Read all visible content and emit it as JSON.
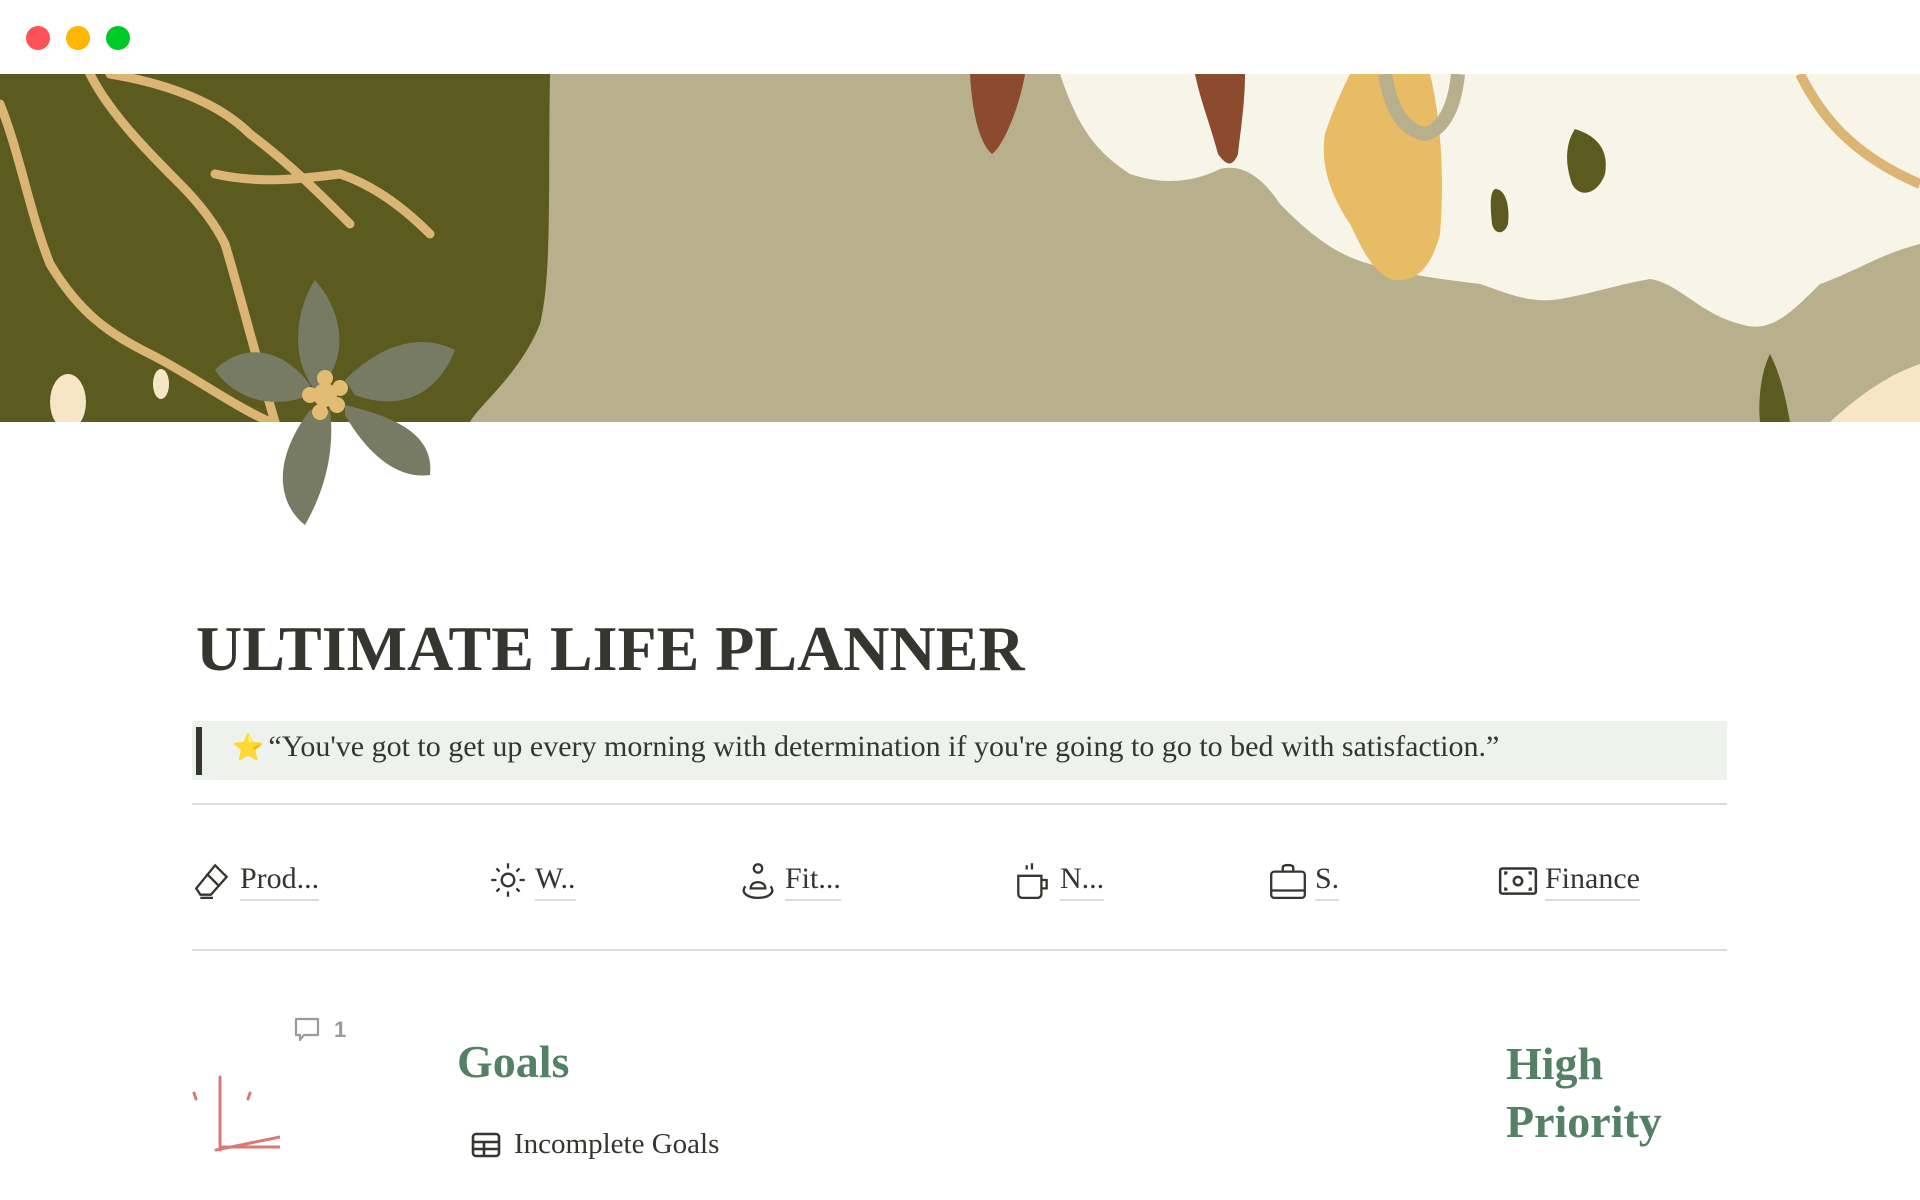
{
  "window": {
    "controls": [
      "close",
      "minimize",
      "maximize"
    ]
  },
  "page": {
    "title": "ULTIMATE LIFE PLANNER",
    "icon": "flower-icon",
    "cover": "botanical-abstract-cover"
  },
  "quote": {
    "icon": "star-icon",
    "star": "⭐",
    "text": "“You've got to get up every morning with determination if you're going to go to bed with satisfaction.”"
  },
  "nav": {
    "items": [
      {
        "label": "Prod...",
        "icon": "eraser-icon"
      },
      {
        "label": "W..",
        "icon": "sun-icon"
      },
      {
        "label": "Fit...",
        "icon": "person-icon"
      },
      {
        "label": "N...",
        "icon": "mug-icon"
      },
      {
        "label": "S.",
        "icon": "bag-icon"
      },
      {
        "label": "Finance",
        "icon": "money-icon"
      }
    ]
  },
  "comments": {
    "icon": "comment-icon",
    "count": "1"
  },
  "sections": {
    "goals": {
      "heading": "Goals",
      "link_label": "Incomplete Goals",
      "link_icon": "table-icon"
    },
    "priority": {
      "heading": "High Priority"
    }
  },
  "colors": {
    "heading_green": "#548164",
    "quote_bg": "#eef2ed",
    "text": "#37352f",
    "divider": "#dcdcdc"
  }
}
